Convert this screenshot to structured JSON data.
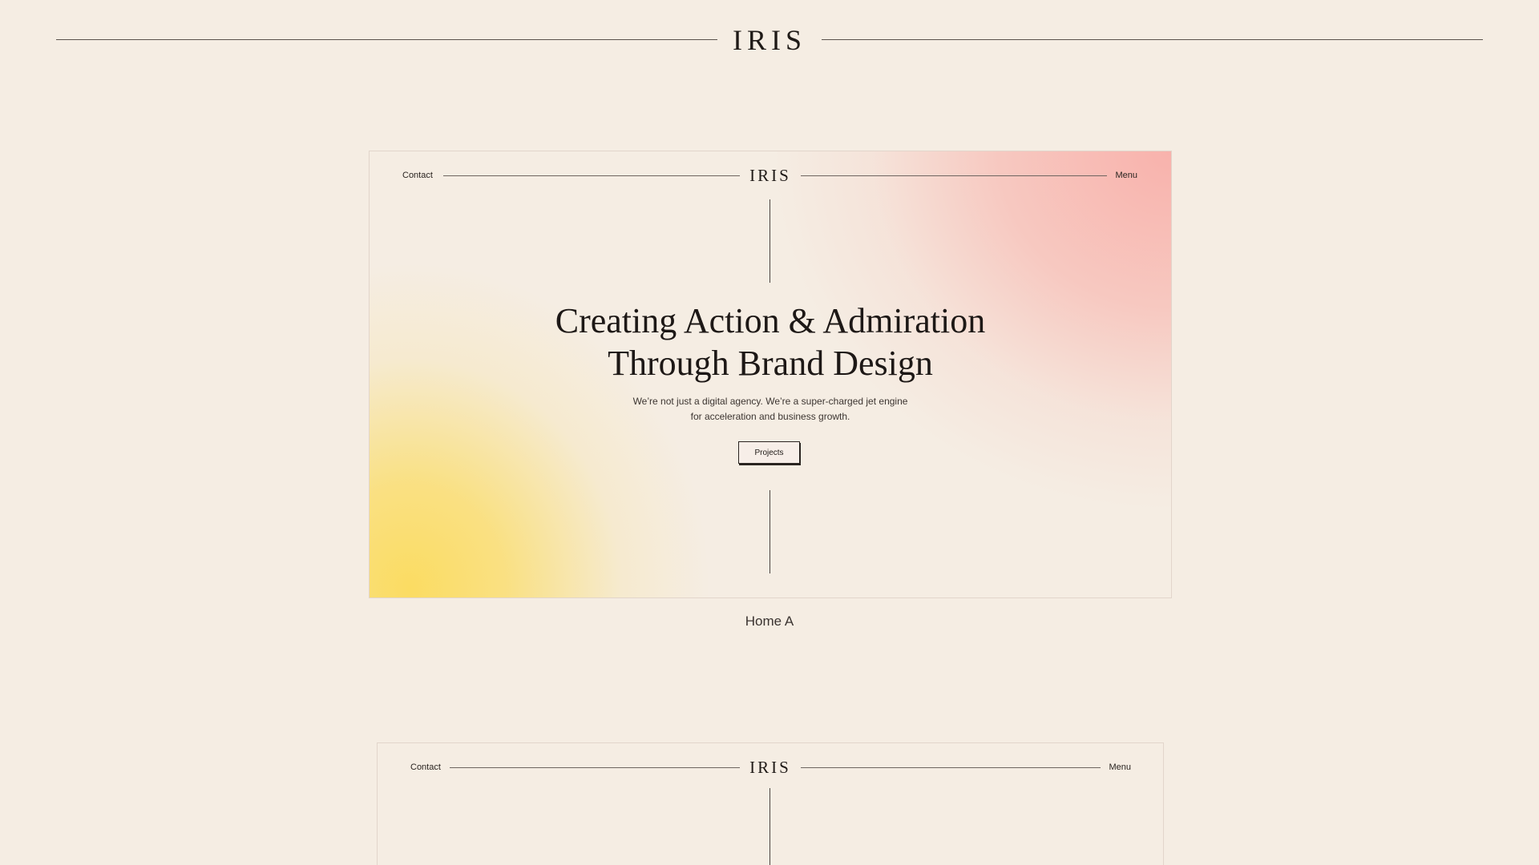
{
  "header": {
    "logo": "IRIS"
  },
  "preview_a": {
    "nav": {
      "contact": "Contact",
      "logo": "IRIS",
      "menu": "Menu"
    },
    "hero": {
      "title_line1": "Creating Action & Admiration",
      "title_line2": "Through Brand Design",
      "subtitle_line1": "We’re not just a digital agency. We’re a super-charged jet engine",
      "subtitle_line2": "for acceleration and business growth.",
      "cta": "Projects"
    },
    "caption": "Home A",
    "colors": {
      "background": "#f5ede3",
      "gradient_yellow": "#fbdc62",
      "gradient_pink": "#f8b2ac"
    }
  },
  "preview_b": {
    "nav": {
      "contact": "Contact",
      "logo": "IRIS",
      "menu": "Menu"
    }
  }
}
